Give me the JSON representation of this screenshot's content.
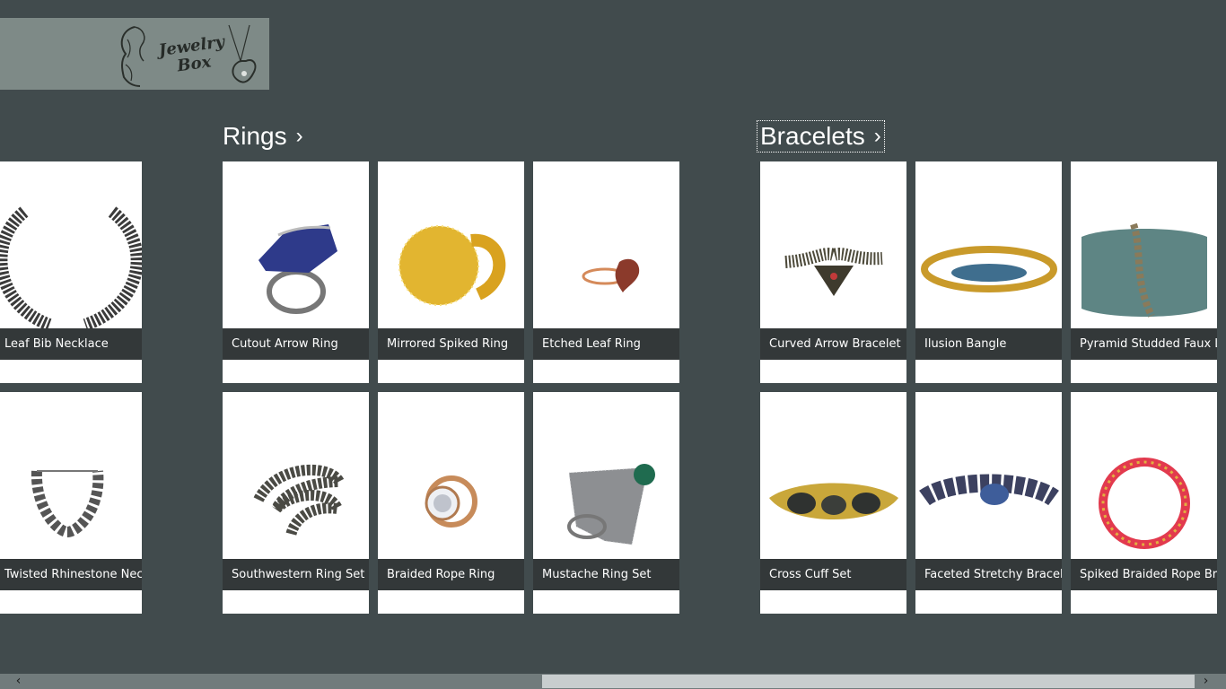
{
  "app": {
    "logo_text_line1": "Jewelry",
    "logo_text_line2": "Box"
  },
  "groups": [
    {
      "title": "Rings",
      "chevron": "›"
    },
    {
      "title": "Bracelets",
      "chevron": "›"
    }
  ],
  "partial_column": [
    {
      "name": "Leaf Bib Necklace",
      "icon": "collar-necklace-image"
    },
    {
      "name": "Twisted Rhinestone Necklace",
      "icon": "rhinestone-collar-image"
    }
  ],
  "rings": [
    {
      "name": "Cutout Arrow Ring",
      "icon": "lapis-cocktail-ring-image"
    },
    {
      "name": "Mirrored Spiked Ring",
      "icon": "gold-pave-dome-ring-image"
    },
    {
      "name": "Etched Leaf Ring",
      "icon": "heart-stone-ring-image"
    },
    {
      "name": "Southwestern Ring Set",
      "icon": "snake-ring-image"
    },
    {
      "name": "Braided Rope Ring",
      "icon": "rose-gold-halo-ring-image"
    },
    {
      "name": "Mustache Ring Set",
      "icon": "fan-emerald-ring-image"
    }
  ],
  "bracelets": [
    {
      "name": "Curved Arrow Bracelet",
      "icon": "beaded-arrow-bracelet-image"
    },
    {
      "name": "Ilusion Bangle",
      "icon": "gold-blue-bangle-image"
    },
    {
      "name": "Pyramid Studded Faux Leather Bracelet",
      "icon": "green-lucite-cuff-image"
    },
    {
      "name": "Cross Cuff Set",
      "icon": "gold-stone-cuff-image"
    },
    {
      "name": "Faceted Stretchy Bracelet",
      "icon": "blue-crystal-bracelet-image"
    },
    {
      "name": "Spiked Braided Rope Bracelet",
      "icon": "red-chain-bracelet-image"
    }
  ],
  "scrollbar": {
    "left_arrow": "‹",
    "right_arrow": "›"
  },
  "colors": {
    "background": "#414b4d",
    "caption_bar": "#333839",
    "logo_bg": "#7e8a87",
    "tile_bg": "#ffffff"
  }
}
